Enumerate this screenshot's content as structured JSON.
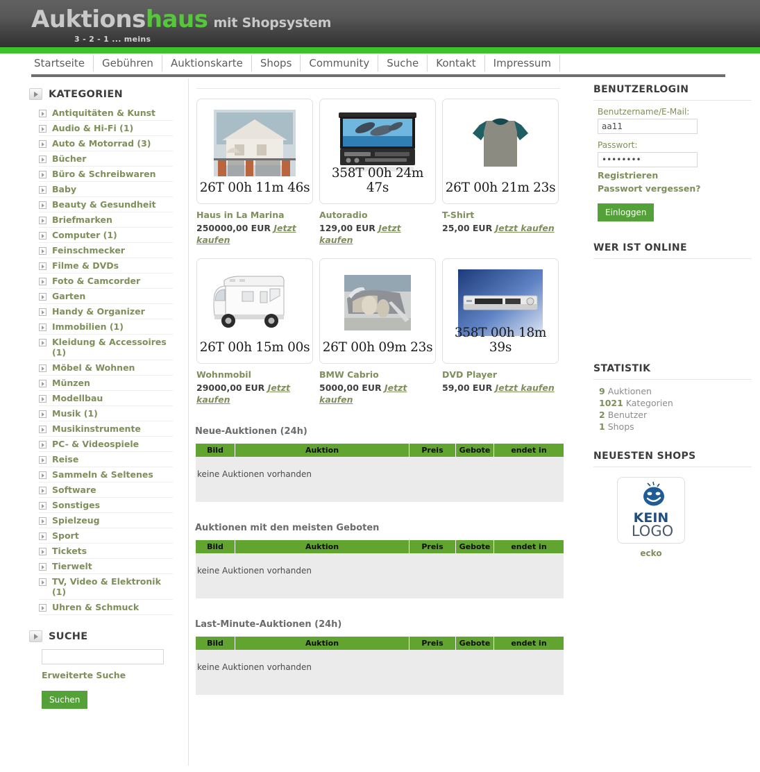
{
  "brand": {
    "name_part1": "Auktions",
    "name_part2": "haus",
    "suffix": "mit Shopsystem",
    "tagline": "3 - 2 - 1 ... meins",
    "green": "#3cc22a",
    "accent_olive": "#7d8f5a"
  },
  "nav": {
    "items": [
      {
        "label": "Startseite"
      },
      {
        "label": "Gebühren"
      },
      {
        "label": "Auktionskarte"
      },
      {
        "label": "Shops"
      },
      {
        "label": "Community"
      },
      {
        "label": "Suche"
      },
      {
        "label": "Kontakt"
      },
      {
        "label": "Impressum"
      }
    ]
  },
  "sidebar": {
    "categories_title": "KATEGORIEN",
    "categories": [
      {
        "label": "Antiquitäten & Kunst"
      },
      {
        "label": "Audio & Hi-Fi (1)"
      },
      {
        "label": "Auto & Motorrad (3)"
      },
      {
        "label": "Bücher"
      },
      {
        "label": "Büro & Schreibwaren"
      },
      {
        "label": "Baby"
      },
      {
        "label": "Beauty & Gesundheit"
      },
      {
        "label": "Briefmarken"
      },
      {
        "label": "Computer (1)"
      },
      {
        "label": "Feinschmecker"
      },
      {
        "label": "Filme & DVDs"
      },
      {
        "label": "Foto & Camcorder"
      },
      {
        "label": "Garten"
      },
      {
        "label": "Handy & Organizer"
      },
      {
        "label": "Immobilien (1)"
      },
      {
        "label": "Kleidung & Accessoires (1)"
      },
      {
        "label": "Möbel & Wohnen"
      },
      {
        "label": "Münzen"
      },
      {
        "label": "Modellbau"
      },
      {
        "label": "Musik (1)"
      },
      {
        "label": "Musikinstrumente"
      },
      {
        "label": "PC- & Videospiele"
      },
      {
        "label": "Reise"
      },
      {
        "label": "Sammeln & Seltenes"
      },
      {
        "label": "Software"
      },
      {
        "label": "Sonstiges"
      },
      {
        "label": "Spielzeug"
      },
      {
        "label": "Sport"
      },
      {
        "label": "Tickets"
      },
      {
        "label": "Tierwelt"
      },
      {
        "label": "TV, Video & Elektronik (1)"
      },
      {
        "label": "Uhren & Schmuck"
      }
    ],
    "search_title": "SUCHE",
    "search_value": "",
    "search_placeholder": "",
    "advanced_search": "Erweiterte Suche",
    "search_button": "Suchen"
  },
  "main": {
    "products": [
      {
        "title": "Haus in La Marina",
        "time": "26T 00h 11m 46s",
        "price": "250000,00 EUR",
        "buy": "Jetzt kaufen",
        "image": "house-photo"
      },
      {
        "title": "Autoradio",
        "time": "358T 00h 24m 47s",
        "price": "129,00 EUR",
        "buy": "Jetzt kaufen",
        "image": "car-radio-photo"
      },
      {
        "title": "T-Shirt",
        "time": "26T 00h 21m 23s",
        "price": "25,00 EUR",
        "buy": "Jetzt kaufen",
        "image": "tshirt-photo"
      },
      {
        "title": "Wohnmobil",
        "time": "26T 00h 15m 00s",
        "price": "29000,00 EUR",
        "buy": "Jetzt kaufen",
        "image": "motorhome-photo"
      },
      {
        "title": "BMW Cabrio",
        "time": "26T 00h 09m 23s",
        "price": "5000,00 EUR",
        "buy": "Jetzt kaufen",
        "image": "convertible-car-photo"
      },
      {
        "title": "DVD Player",
        "time": "358T 00h 18m 39s",
        "price": "59,00 EUR",
        "buy": "Jetzt kaufen",
        "image": "dvd-player-photo"
      }
    ],
    "table_columns": [
      "Bild",
      "Auktion",
      "Preis",
      "Gebote",
      "endet in"
    ],
    "empty_text": "keine Auktionen vorhanden",
    "sections": [
      {
        "title": "Neue-Auktionen (24h)"
      },
      {
        "title": "Auktionen mit den meisten Geboten"
      },
      {
        "title": "Last-Minute-Auktionen (24h)"
      }
    ]
  },
  "right": {
    "login_title": "BENUTZERLOGIN",
    "username_label": "Benutzername/E-Mail:",
    "username_value": "aa11",
    "password_label": "Passwort:",
    "password_value": "••••••••",
    "register_link": "Registrieren",
    "forgot_link": "Passwort vergessen?",
    "login_button": "Einloggen",
    "online_title": "WER IST ONLINE",
    "stats_title": "STATISTIK",
    "stats": [
      {
        "value": "9",
        "label": "Auktionen"
      },
      {
        "value": "1021",
        "label": "Kategorien"
      },
      {
        "value": "2",
        "label": "Benutzer"
      },
      {
        "value": "1",
        "label": "Shops"
      }
    ],
    "shops_title": "NEUESTEN SHOPS",
    "shop_logo_line1": "KEIN",
    "shop_logo_line2": "LOGO",
    "shop_name": "ecko"
  }
}
